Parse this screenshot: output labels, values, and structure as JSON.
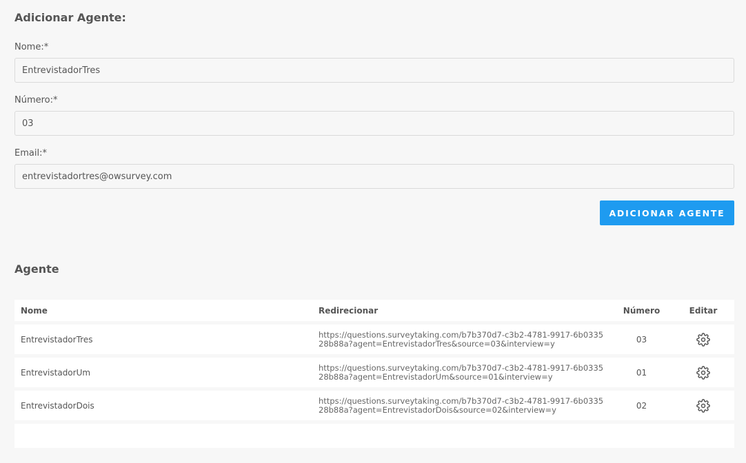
{
  "form": {
    "title": "Adicionar Agente:",
    "fields": {
      "name": {
        "label": "Nome:*",
        "value": "EntrevistadorTres"
      },
      "number": {
        "label": "Número:*",
        "value": "03"
      },
      "email": {
        "label": "Email:*",
        "value": "entrevistadortres@owsurvey.com"
      }
    },
    "submit_label": "ADICIONAR AGENTE"
  },
  "colors": {
    "accent": "#1e9bf0"
  },
  "list": {
    "title": "Agente",
    "columns": [
      "Nome",
      "Redirecionar",
      "Número",
      "Editar"
    ],
    "rows": [
      {
        "name": "EntrevistadorTres",
        "redirect": "https://questions.surveytaking.com/b7b370d7-c3b2-4781-9917-6b033528b88a?agent=EntrevistadorTres&source=03&interview=y",
        "number": "03",
        "edit_icon": "gear-icon"
      },
      {
        "name": "EntrevistadorUm",
        "redirect": "https://questions.surveytaking.com/b7b370d7-c3b2-4781-9917-6b033528b88a?agent=EntrevistadorUm&source=01&interview=y",
        "number": "01",
        "edit_icon": "gear-icon"
      },
      {
        "name": "EntrevistadorDois",
        "redirect": "https://questions.surveytaking.com/b7b370d7-c3b2-4781-9917-6b033528b88a?agent=EntrevistadorDois&source=02&interview=y",
        "number": "02",
        "edit_icon": "gear-icon"
      }
    ]
  }
}
